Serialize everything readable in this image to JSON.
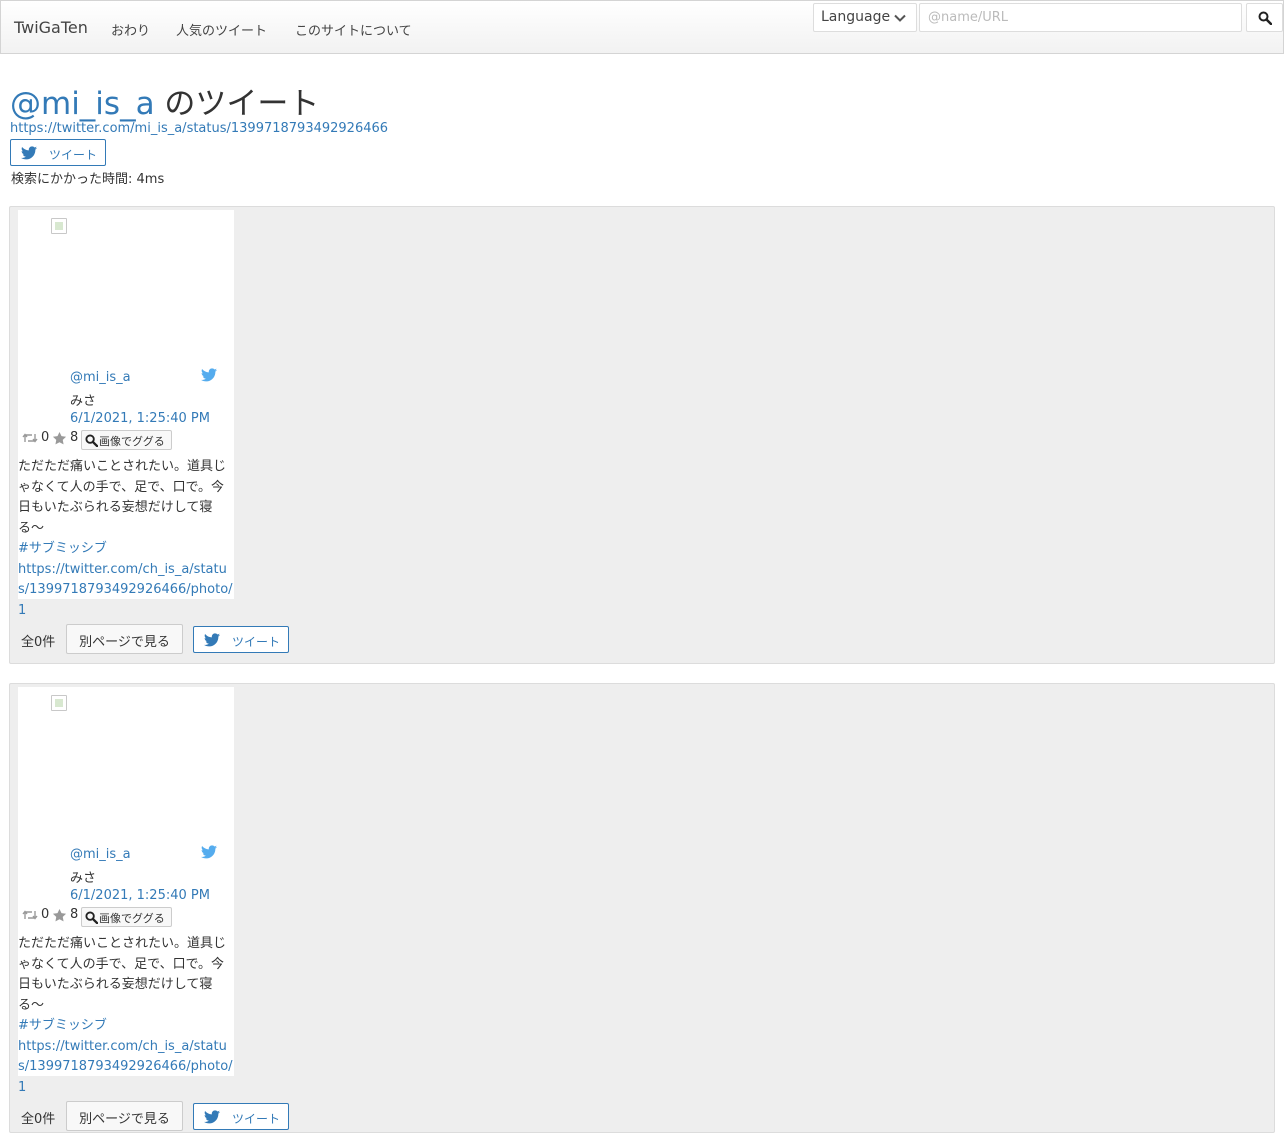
{
  "nav": {
    "brand": "TwiGaTen",
    "items": [
      "おわり",
      "人気のツイート",
      "このサイトについて"
    ],
    "language_label": "Language",
    "search_placeholder": "@name/URL"
  },
  "header": {
    "user": "@mi_is_a",
    "title_suffix": " のツイート",
    "status_url": "https://twitter.com/mi_is_a/status/1399718793492926466",
    "tweet_label": "ツイート",
    "search_time": "検索にかかった時間: 4ms"
  },
  "panels": [
    {
      "card": {
        "handle": "@mi_is_a",
        "name": "みさ",
        "datetime": "6/1/2021, 1:25:40 PM",
        "retweets": "0",
        "favorites": "8",
        "google_label": "画像でググる",
        "text": "ただただ痛いことされたい。道具じゃなくて人の手で、足で、口で。今日もいたぶられる妄想だけして寝る〜",
        "hashtag": "#サブミッシブ",
        "photo_link": "https://twitter.com/ch_is_a/status/1399718793492926466/photo/1"
      },
      "total": "全0件",
      "other_page_label": "別ページで見る",
      "tweet_label": "ツイート"
    },
    {
      "card": {
        "handle": "@mi_is_a",
        "name": "みさ",
        "datetime": "6/1/2021, 1:25:40 PM",
        "retweets": "0",
        "favorites": "8",
        "google_label": "画像でググる",
        "text": "ただただ痛いことされたい。道具じゃなくて人の手で、足で、口で。今日もいたぶられる妄想だけして寝る〜",
        "hashtag": "#サブミッシブ",
        "photo_link": "https://twitter.com/ch_is_a/status/1399718793492926466/photo/1"
      },
      "total": "全0件",
      "other_page_label": "別ページで見る",
      "tweet_label": "ツイート"
    }
  ],
  "colors": {
    "link": "#337ab7",
    "twitter_blue": "#55acee",
    "panel_bg": "#eeeeee"
  }
}
